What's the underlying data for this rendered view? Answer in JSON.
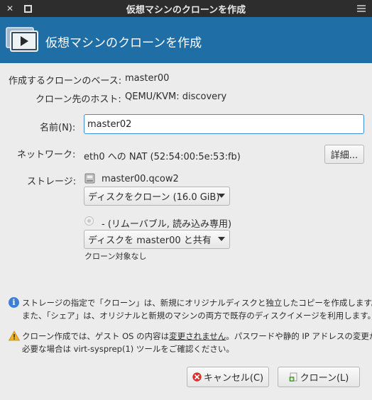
{
  "window": {
    "title": "仮想マシンのクローンを作成"
  },
  "header": {
    "title": "仮想マシンのクローンを作成"
  },
  "form": {
    "base_label": "作成するクローンのベース:",
    "base_value": "master00",
    "host_label": "クローン先のホスト:",
    "host_value": "QEMU/KVM: discovery",
    "name_label": "名前(N):",
    "name_value": "master02",
    "network_label": "ネットワーク:",
    "network_value": "eth0 への NAT (52:54:00:5e:53:fb)",
    "details_button": "詳細...",
    "storage_label": "ストレージ:",
    "storage_disk1_name": "master00.qcow2",
    "storage_disk1_action": "ディスクをクローン (16.0 GiB)",
    "storage_disk2_name": "- (リムーバブル, 読み込み専用)",
    "storage_disk2_action": "ディスクを master00 と共有",
    "storage_disk2_note": "クローン対象なし"
  },
  "info": {
    "line1": "ストレージの指定で「クローン」は、新規にオリジナルディスクと独立したコピーを作成します。",
    "line2": "また、「シェア」は、オリジナルと新規のマシンの両方で既存のディスクイメージを利用します。"
  },
  "warning": {
    "line1_pre": "クローン作成では、ゲスト OS の内容は",
    "line1_underlined": "変更されません",
    "line1_post": "。パスワードや静的 IP アドレスの変更が",
    "line2": "必要な場合は virt-sysprep(1) ツールをご確認ください。"
  },
  "buttons": {
    "cancel": "キャンセル(C)",
    "clone": "クローン(L)"
  },
  "colors": {
    "titlebar": "#2d2d2d",
    "header": "#1f6ea6",
    "background": "#ececec",
    "input_focus": "#3d8ed6",
    "cancel_icon": "#d8302b",
    "info_icon": "#3b80d6",
    "warning_icon": "#f0b323"
  }
}
